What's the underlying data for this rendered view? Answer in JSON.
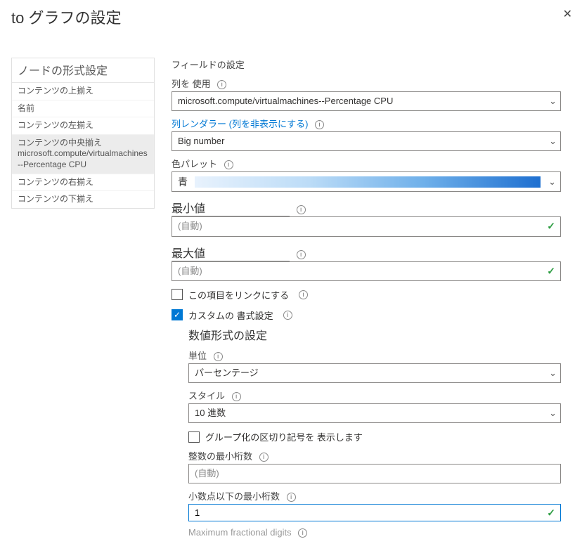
{
  "header": {
    "title": "to グラフの設定"
  },
  "sidebar": {
    "title": "ノードの形式設定",
    "items": [
      {
        "label": "コンテンツの上揃え",
        "selected": false
      },
      {
        "label": "名前",
        "selected": false
      },
      {
        "label": "コンテンツの左揃え",
        "selected": false
      },
      {
        "label": "コンテンツの中央揃え\nmicrosoft.compute/virtualmachines--Percentage CPU",
        "selected": true
      },
      {
        "label": "コンテンツの右揃え",
        "selected": false
      },
      {
        "label": "コンテンツの下揃え",
        "selected": false
      }
    ]
  },
  "main": {
    "field_settings_label": "フィールドの設定",
    "use_column_label": "列を 使用",
    "use_column_value": "microsoft.compute/virtualmachines--Percentage CPU",
    "renderer_label": "列レンダラー (列を非表示にする)",
    "renderer_value": "Big number",
    "palette_label": "色パレット",
    "palette_value": "青",
    "min_label": "最小値",
    "min_placeholder": "(自動)",
    "max_label": "最大値",
    "max_placeholder": "(自動)",
    "make_link_label": "この項目をリンクにする",
    "make_link_checked": false,
    "custom_format_label": "カスタムの 書式設定",
    "custom_format_checked": true,
    "number_format_heading": "数値形式の設定",
    "unit_label": "単位",
    "unit_value": "パーセンテージ",
    "style_label": "スタイル",
    "style_value": "10 進数",
    "group_sep_label": "グループ化の区切り記号を 表示します",
    "group_sep_checked": false,
    "min_int_digits_label": "整数の最小桁数",
    "min_int_digits_placeholder": "(自動)",
    "min_frac_digits_label": "小数点以下の最小桁数",
    "min_frac_digits_value": "1",
    "max_frac_digits_label": "Maximum fractional digits"
  },
  "icons": {
    "info": "i",
    "chevron": "⌄",
    "check": "✓"
  }
}
